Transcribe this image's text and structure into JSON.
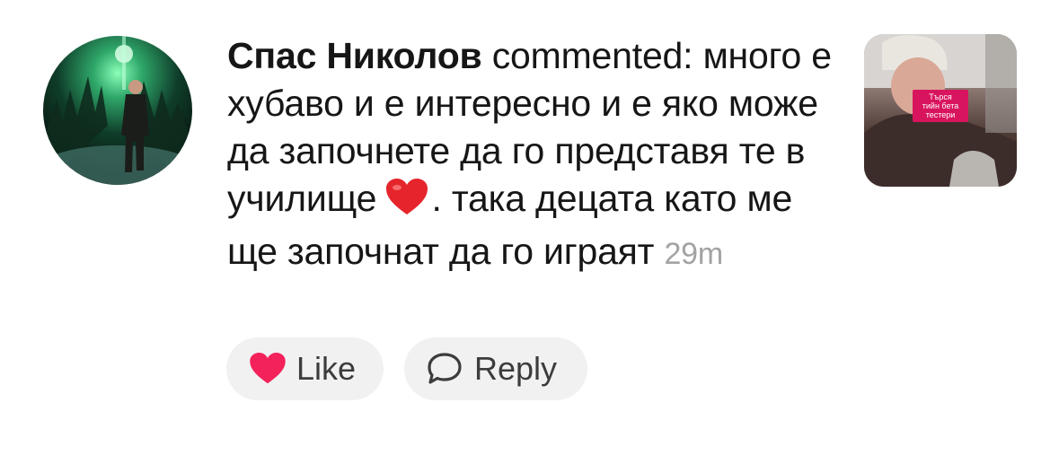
{
  "comment": {
    "author": "Спас Николов",
    "verb": "commented:",
    "text_part1": "много е хубаво и е интересно и е яко може да започнете да го представя те в училище",
    "text_part2": ". така децата като ме ще започнат да го играят",
    "time": "29m",
    "emoji": "red-heart-emoji"
  },
  "thumbnail": {
    "caption": "Търся\nтийн бета\nтестери"
  },
  "actions": {
    "like_label": "Like",
    "reply_label": "Reply",
    "like_icon": "heart-icon",
    "reply_icon": "speech-bubble-icon"
  },
  "colors": {
    "like_heart": "#f3225a",
    "muted_time": "#a3a3a3",
    "pill_bg": "#f1f1f2"
  }
}
